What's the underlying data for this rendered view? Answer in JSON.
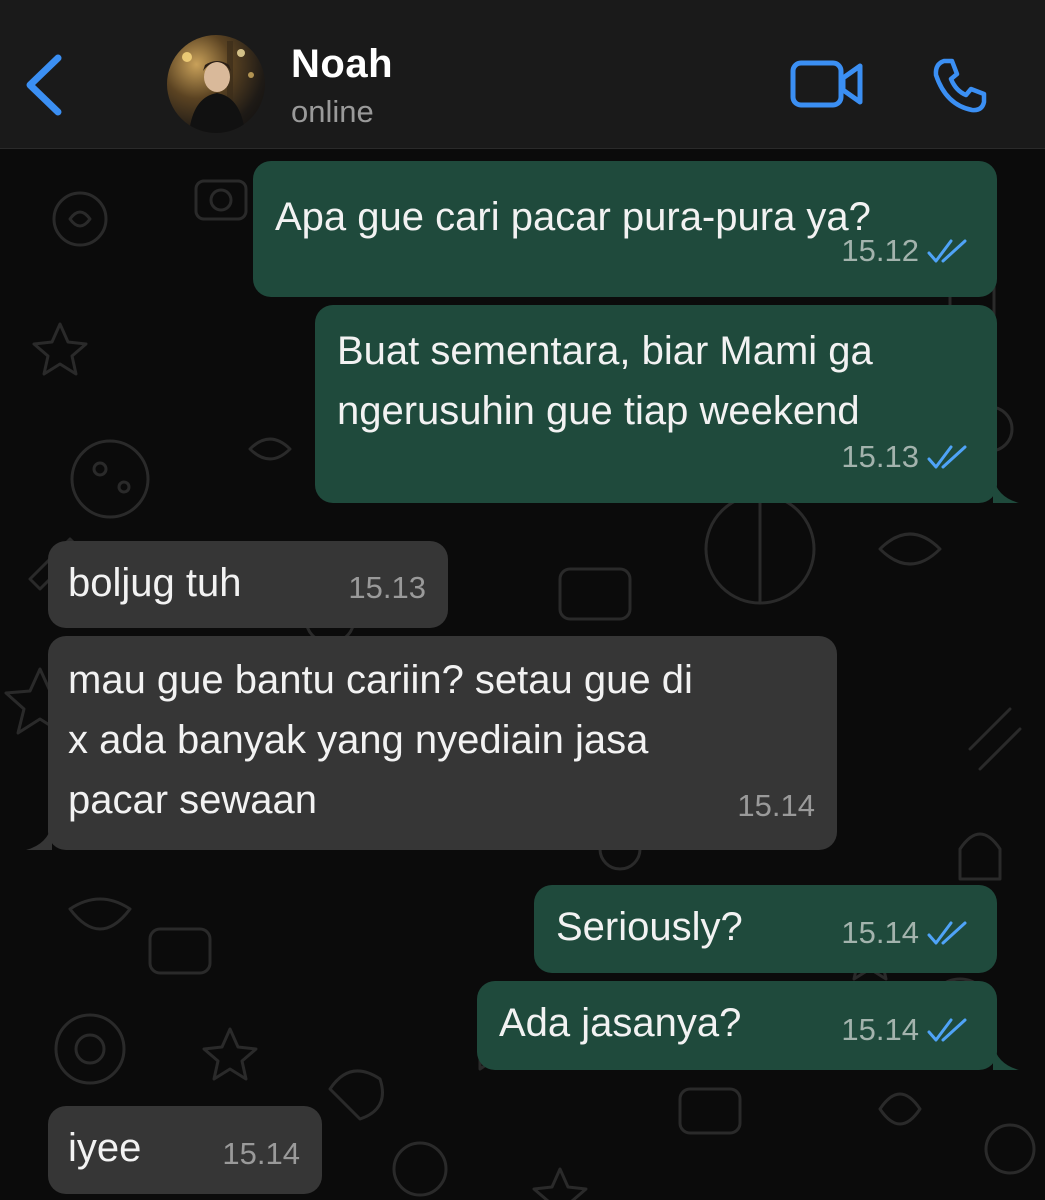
{
  "header": {
    "contact_name": "Noah",
    "contact_status": "online"
  },
  "colors": {
    "accent": "#3b8ff3",
    "outgoing_bubble": "#1f4a3c",
    "incoming_bubble": "#363636",
    "read_ticks": "#4fa3f7"
  },
  "icons": {
    "back": "chevron-left-icon",
    "video": "video-camera-icon",
    "call": "phone-icon",
    "read_receipt": "double-check-icon"
  },
  "messages": [
    {
      "direction": "outgoing",
      "lines": [
        "Apa gue cari pacar pura-pura ya?"
      ],
      "time": "15.12",
      "read": true
    },
    {
      "direction": "outgoing",
      "lines": [
        "Buat sementara, biar Mami ga",
        "ngerusuhin gue tiap weekend"
      ],
      "time": "15.13",
      "read": true
    },
    {
      "direction": "incoming",
      "lines": [
        "boljug tuh"
      ],
      "time": "15.13"
    },
    {
      "direction": "incoming",
      "lines": [
        "mau gue bantu cariin? setau gue di",
        "x ada banyak yang nyediain jasa",
        "pacar sewaan"
      ],
      "time": "15.14"
    },
    {
      "direction": "outgoing",
      "lines": [
        "Seriously?"
      ],
      "time": "15.14",
      "read": true
    },
    {
      "direction": "outgoing",
      "lines": [
        "Ada jasanya?"
      ],
      "time": "15.14",
      "read": true
    },
    {
      "direction": "incoming",
      "lines": [
        "iyee"
      ],
      "time": "15.14"
    }
  ]
}
